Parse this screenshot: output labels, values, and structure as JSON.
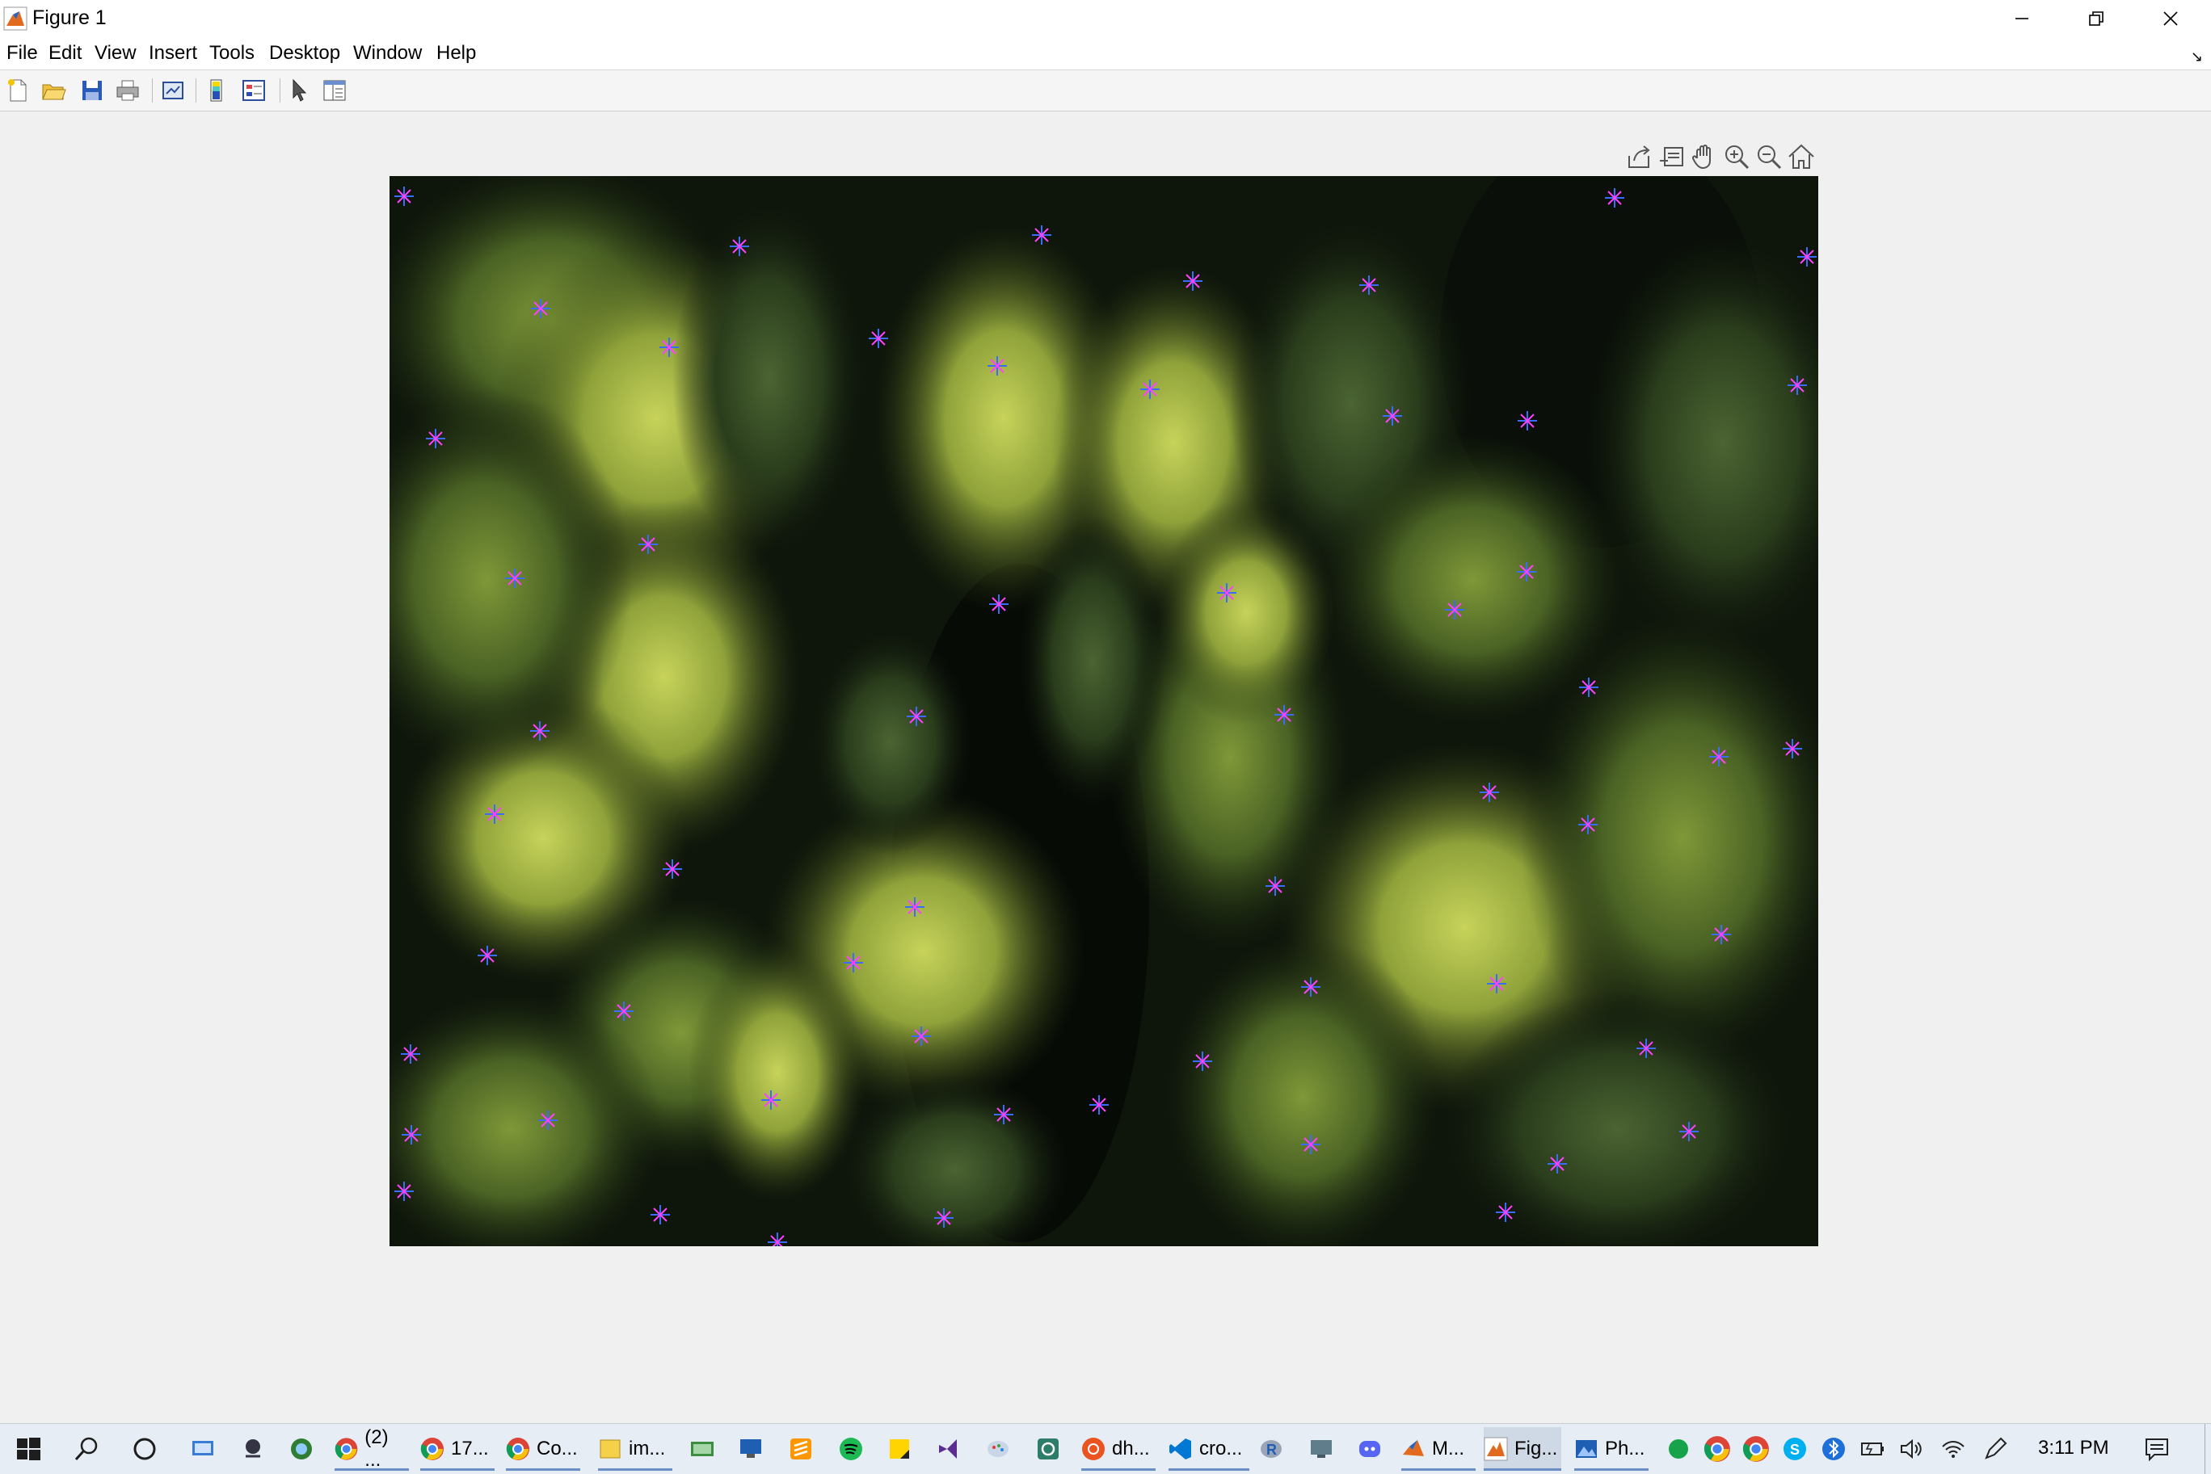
{
  "window": {
    "title": "Figure 1"
  },
  "menu": [
    "File",
    "Edit",
    "View",
    "Insert",
    "Tools",
    "Desktop",
    "Window",
    "Help"
  ],
  "toolbar": {
    "buttons": [
      "new-figure",
      "open-file",
      "save-figure",
      "print-figure",
      "link-plot",
      "insert-colorbar",
      "insert-legend",
      "edit-plot",
      "open-property-inspector"
    ]
  },
  "axes_toolbar": [
    "export",
    "brush",
    "pan",
    "zoom-in",
    "zoom-out",
    "restore-view"
  ],
  "image": {
    "subject": "aerial conifer forest",
    "marker_style": "plus and cross overlay",
    "marker_colors": {
      "plus": "#3a6cff",
      "cross": "#ff40ff"
    },
    "marker_count": 57
  },
  "taskbar": {
    "apps": [
      {
        "label": "(2) ...",
        "icon": "chrome-icon"
      },
      {
        "label": "17...",
        "icon": "chrome-icon"
      },
      {
        "label": "Co...",
        "icon": "chrome-icon"
      },
      {
        "label": "im...",
        "icon": "folder-icon"
      },
      {
        "label": "dh...",
        "icon": "ubuntu-icon"
      },
      {
        "label": "cro...",
        "icon": "vscode-icon"
      },
      {
        "label": "M...",
        "icon": "matlab-icon"
      },
      {
        "label": "Fig...",
        "icon": "matlab-figure-icon"
      },
      {
        "label": "Ph...",
        "icon": "photos-icon"
      }
    ],
    "clock": "3:11 PM"
  }
}
